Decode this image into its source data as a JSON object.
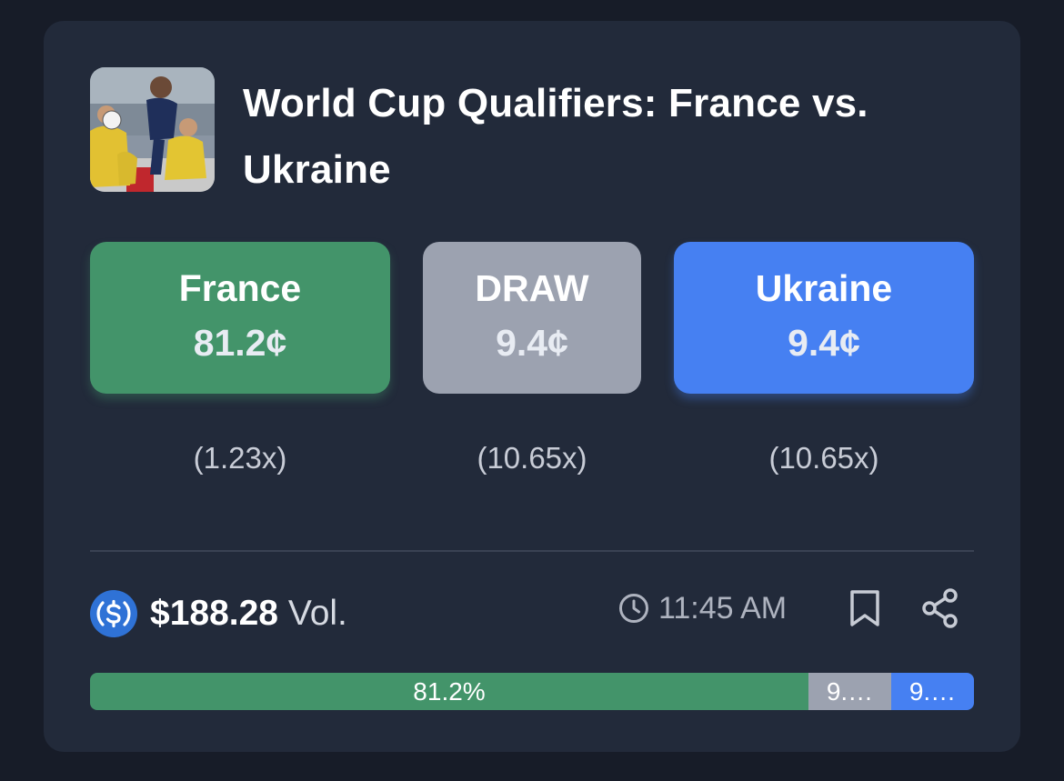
{
  "market": {
    "title": "World Cup Qualifiers: France vs. Ukraine"
  },
  "outcomes": [
    {
      "name": "France",
      "price": "81.2¢",
      "multiplier": "(1.23x)",
      "color": "#43946a"
    },
    {
      "name": "DRAW",
      "price": "9.4¢",
      "multiplier": "(10.65x)",
      "color": "#9ca2b0"
    },
    {
      "name": "Ukraine",
      "price": "9.4¢",
      "multiplier": "(10.65x)",
      "color": "#4680f2"
    }
  ],
  "footer": {
    "volume_amount": "$188.28",
    "volume_label": "Vol.",
    "time": "11:45 AM",
    "currency_icon": "usdc-icon",
    "time_icon": "clock-icon",
    "bookmark_icon": "bookmark-icon",
    "share_icon": "share-icon"
  },
  "distribution": {
    "segments": [
      {
        "label": "81.2%",
        "percent": 81.2,
        "color": "#43946a"
      },
      {
        "label": "9.…",
        "percent": 9.4,
        "color": "#9ca2b0"
      },
      {
        "label": "9.…",
        "percent": 9.4,
        "color": "#4680f2"
      }
    ]
  }
}
